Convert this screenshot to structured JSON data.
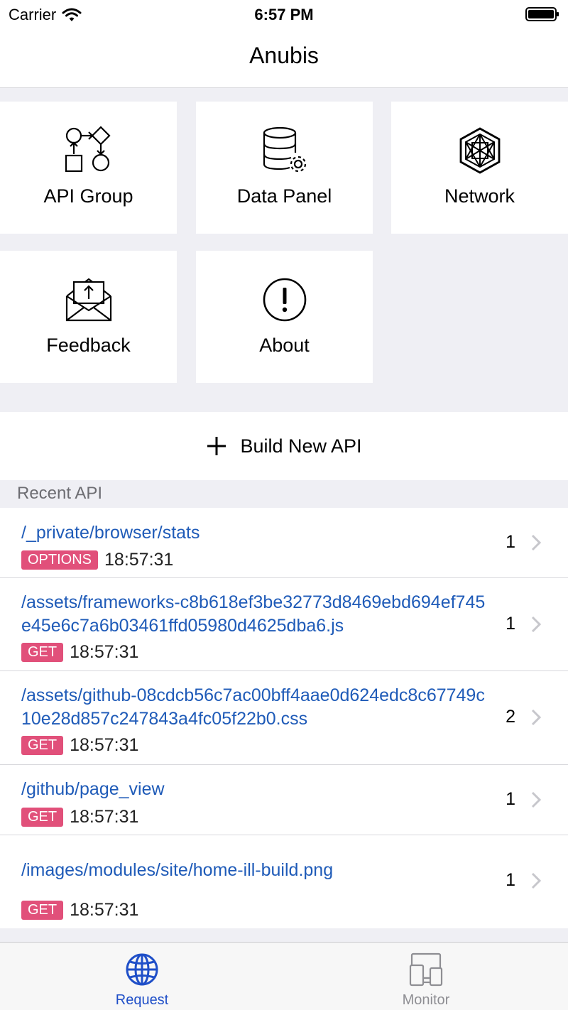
{
  "status_bar": {
    "carrier": "Carrier",
    "time": "6:57 PM"
  },
  "nav": {
    "title": "Anubis"
  },
  "tiles": [
    {
      "label": "API Group",
      "icon": "flowchart-icon"
    },
    {
      "label": "Data Panel",
      "icon": "database-settings-icon"
    },
    {
      "label": "Network",
      "icon": "network-hexagon-icon"
    },
    {
      "label": "Feedback",
      "icon": "mail-upload-icon"
    },
    {
      "label": "About",
      "icon": "exclamation-circle-icon"
    }
  ],
  "build_button": {
    "label": "Build New API",
    "icon": "plus-icon"
  },
  "recent": {
    "header": "Recent API",
    "items": [
      {
        "path": "/_private/browser/stats",
        "method": "OPTIONS",
        "time": "18:57:31",
        "count": "1"
      },
      {
        "path": "/assets/frameworks-c8b618ef3be32773d8469ebd694ef745e45e6c7a6b03461ffd05980d4625dba6.js",
        "method": "GET",
        "time": "18:57:31",
        "count": "1"
      },
      {
        "path": "/assets/github-08cdcb56c7ac00bff4aae0d624edc8c67749c10e28d857c247843a4fc05f22b0.css",
        "method": "GET",
        "time": "18:57:31",
        "count": "2"
      },
      {
        "path": "/github/page_view",
        "method": "GET",
        "time": "18:57:31",
        "count": "1"
      },
      {
        "path": "/images/modules/site/home-ill-build.png",
        "method": "GET",
        "time": "18:57:31",
        "count": "1"
      }
    ]
  },
  "tab_bar": {
    "tabs": [
      {
        "label": "Request",
        "icon": "globe-icon",
        "selected": true
      },
      {
        "label": "Monitor",
        "icon": "devices-icon",
        "selected": false
      }
    ]
  },
  "colors": {
    "accent": "#1f4fc8",
    "link": "#1f5bb8",
    "badge": "#e1507a",
    "inactive": "#8e8e93"
  }
}
